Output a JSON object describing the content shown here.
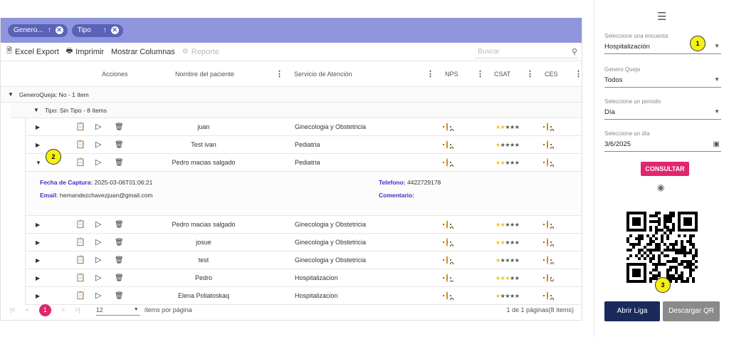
{
  "group_chips": [
    {
      "label": "Genero...",
      "arrow": "↑",
      "close": "✕"
    },
    {
      "label": "Tipo",
      "arrow": "↑",
      "close": "✕"
    }
  ],
  "toolbar": {
    "excel": "Excel Export",
    "print": "Imprimir",
    "columns": "Mostrar Columnas",
    "report": "Reporte",
    "search_placeholder": "Buscar"
  },
  "columns": {
    "actions": "Acciones",
    "patient": "Nombre del paciente",
    "service": "Servicio de Atención",
    "nps": "NPS",
    "csat": "CSAT",
    "ces": "CES"
  },
  "group1": "GeneroQueja: No - 1 ítem",
  "group2": "Tipo: Sin Tipo - 8 ítems",
  "rows": [
    {
      "name": "juan",
      "service": "Ginecologia y Obstetricia",
      "nps": "sad",
      "csat": 2,
      "ces": "sad",
      "expanded": false
    },
    {
      "name": "Test ivan",
      "service": "Pediatria",
      "nps": "sad",
      "csat": 1,
      "ces": "sad",
      "expanded": false
    },
    {
      "name": "Pedro macias salgado",
      "service": "Pediatria",
      "nps": "sad",
      "csat": 2,
      "ces": "sad",
      "expanded": true
    },
    {
      "name": "Pedro macias salgado",
      "service": "Ginecologia y Obstetricia",
      "nps": "sad",
      "csat": 2,
      "ces": "sad",
      "expanded": false
    },
    {
      "name": "josue",
      "service": "Ginecologia y Obstetricia",
      "nps": "sad",
      "csat": 2,
      "ces": "sad",
      "expanded": false
    },
    {
      "name": "test",
      "service": "Ginecologia y Obstetricia",
      "nps": "sad",
      "csat": 1,
      "ces": "sad",
      "expanded": false
    },
    {
      "name": "Pedro",
      "service": "Hospitalizacion",
      "nps": "neutral",
      "csat": 3,
      "ces": "happy",
      "expanded": false
    },
    {
      "name": "Elena Poliatoskaq",
      "service": "Hospitalizacion",
      "nps": "sad",
      "csat": 1,
      "ces": "sad",
      "expanded": false
    }
  ],
  "detail": {
    "capture_label": "Fecha de Captura:",
    "capture_value": "2025-03-06T01:06:21",
    "email_label": "Email:",
    "email_value": "hernandezchavezjuan@gmail.com",
    "phone_label": "Telefono:",
    "phone_value": "4422729178",
    "comment_label": "Comentario:"
  },
  "pager": {
    "current_page": "1",
    "page_size": "12",
    "per_page": "ítems por página",
    "info": "1 de 1 páginas(8 ítems)"
  },
  "side": {
    "survey_label": "Seleccione una encuesta",
    "survey_value": "Hospitalización",
    "genero_label": "Genero Queja",
    "genero_value": "Todos",
    "period_label": "Seleccione un periodo",
    "period_value": "Día",
    "day_label": "Seleccione un día",
    "day_value": "3/6/2025",
    "consultar": "CONSULTAR",
    "open_link": "Abrir Liga",
    "download_qr": "Descargar QR"
  },
  "badges": [
    "1",
    "2",
    "3"
  ],
  "colors": {
    "accent": "#e0266e",
    "group_bar": "#8f96de",
    "primary_dark": "#1a2a5b"
  }
}
